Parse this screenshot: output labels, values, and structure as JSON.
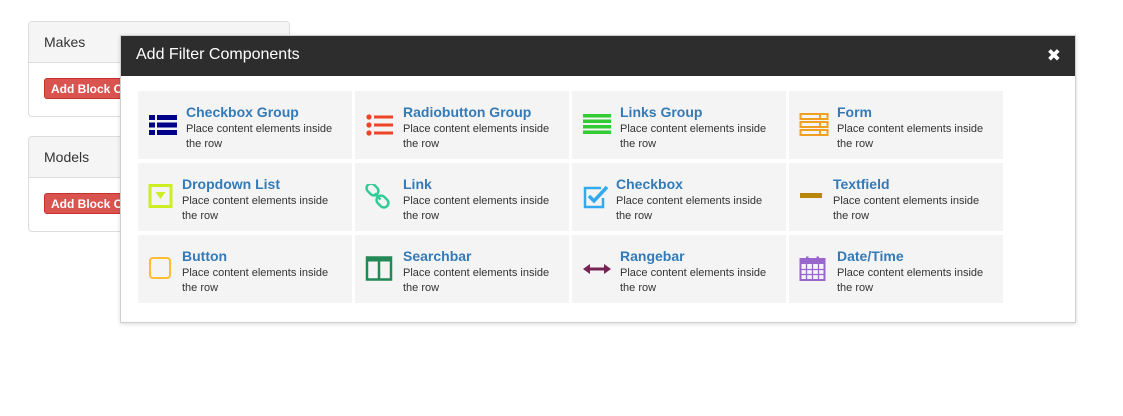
{
  "background": {
    "panels": [
      {
        "title": "Makes",
        "button_label": "Add Block Co"
      },
      {
        "title": "Models",
        "button_label": "Add Block Co"
      }
    ]
  },
  "modal": {
    "title": "Add Filter Components",
    "close_symbol": "✖",
    "components": [
      {
        "title": "Checkbox Group",
        "desc": "Place content elements inside the row",
        "icon": "list-icon",
        "color": "#00008b"
      },
      {
        "title": "Radiobutton Group",
        "desc": "Place content elements inside the row",
        "icon": "radio-list-icon",
        "color": "#ee4426"
      },
      {
        "title": "Links Group",
        "desc": "Place content elements inside the row",
        "icon": "bars-icon",
        "color": "#33cc33"
      },
      {
        "title": "Form",
        "desc": "Place content elements inside the row",
        "icon": "form-icon",
        "color": "#f0a020"
      },
      {
        "title": "Dropdown List",
        "desc": "Place content elements inside the row",
        "icon": "dropdown-icon",
        "color": "#ccee22"
      },
      {
        "title": "Link",
        "desc": "Place content elements inside the row",
        "icon": "chain-link-icon",
        "color": "#33cc99"
      },
      {
        "title": "Checkbox",
        "desc": "Place content elements inside the row",
        "icon": "checkbox-icon",
        "color": "#33aaee"
      },
      {
        "title": "Textfield",
        "desc": "Place content elements inside the row",
        "icon": "textfield-icon",
        "color": "#b8860b"
      },
      {
        "title": "Button",
        "desc": "Place content elements inside the row",
        "icon": "button-icon",
        "color": "#ffbb33"
      },
      {
        "title": "Searchbar",
        "desc": "Place content elements inside the row",
        "icon": "columns-icon",
        "color": "#228855"
      },
      {
        "title": "Rangebar",
        "desc": "Place content elements inside the row",
        "icon": "range-arrows-icon",
        "color": "#772255"
      },
      {
        "title": "Date/Time",
        "desc": "Place content elements inside the row",
        "icon": "calendar-icon",
        "color": "#9966cc"
      }
    ]
  }
}
